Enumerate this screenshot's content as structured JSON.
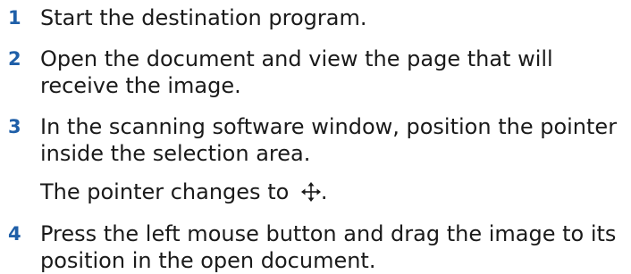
{
  "steps": [
    {
      "number": "1",
      "text": "Start the destination program."
    },
    {
      "number": "2",
      "text": "Open the document and view the page that will receive the image."
    },
    {
      "number": "3",
      "text": "In the scanning software window, position the pointer inside the selection area."
    },
    {
      "number": "4",
      "text": "Press the left mouse button and drag the image to its position in the open document."
    }
  ],
  "note": {
    "text_before": "The pointer changes to",
    "icon": "move-cursor-icon",
    "text_after": "."
  },
  "colors": {
    "step_number": "#1f5fa8",
    "text": "#1a1a1a"
  }
}
